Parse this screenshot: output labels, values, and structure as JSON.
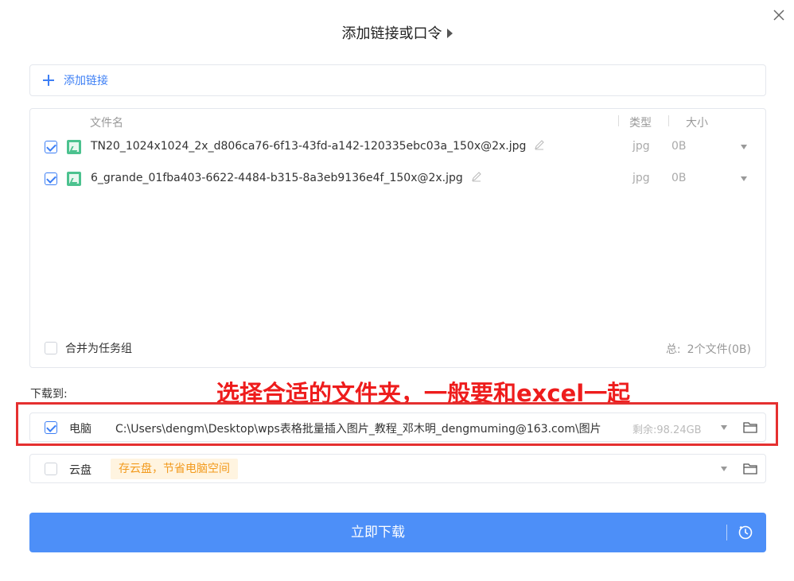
{
  "dialog": {
    "title": "添加链接或口令"
  },
  "add_link": {
    "label": "添加链接"
  },
  "file_list": {
    "headers": {
      "name": "文件名",
      "type": "类型",
      "size": "大小"
    },
    "files": [
      {
        "name": "TN20_1024x1024_2x_d806ca76-6f13-43fd-a142-120335ebc03a_150x@2x.jpg",
        "type": "jpg",
        "size": "0B",
        "checked": true
      },
      {
        "name": "6_grande_01fba403-6622-4484-b315-8a3eb9136e4f_150x@2x.jpg",
        "type": "jpg",
        "size": "0B",
        "checked": true
      }
    ],
    "merge_label": "合并为任务组",
    "total_label": "总:",
    "total_value": "2个文件(0B)"
  },
  "download_to": {
    "label": "下载到:",
    "computer": {
      "label": "电脑",
      "path": "C:\\Users\\dengm\\Desktop\\wps表格批量插入图片_教程_邓木明_dengmuming@163.com\\图片",
      "free_space": "剩余:98.24GB",
      "checked": true
    },
    "cloud": {
      "label": "云盘",
      "tip": "存云盘，节省电脑空间",
      "checked": false
    }
  },
  "annotation": {
    "text": "选择合适的文件夹，一般要和excel一起",
    "color": "#ee1c1c"
  },
  "download_button": {
    "label": "立即下载",
    "color": "#4d8ff8"
  }
}
